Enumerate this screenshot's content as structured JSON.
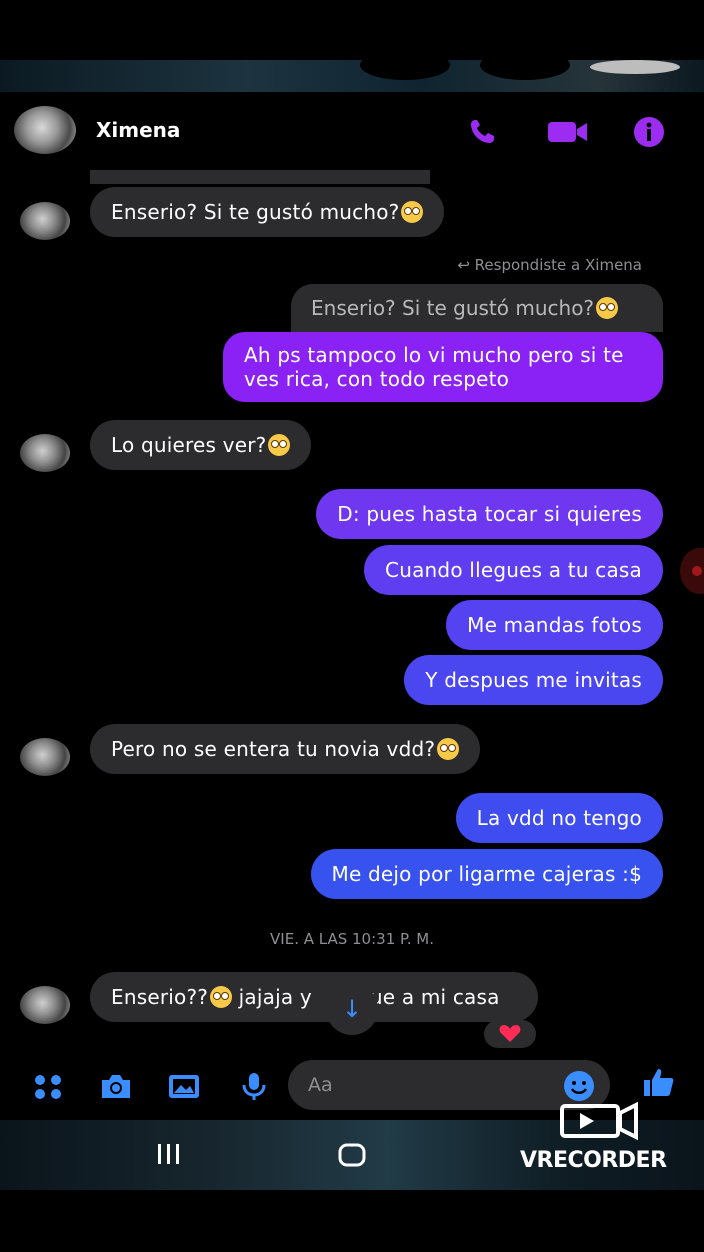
{
  "colors": {
    "accent_purple": "#9b2cf0",
    "accent_blue": "#3a8dff",
    "incoming_bubble": "#2c2c2e",
    "background": "#000000"
  },
  "header": {
    "contact_name": "Ximena",
    "icons": [
      "phone-icon",
      "video-camera-icon",
      "info-icon"
    ]
  },
  "reply_label": "Respondiste a Ximena",
  "messages": [
    {
      "side": "in",
      "text": "Enserio? Si te gustó mucho?",
      "emoji": true
    },
    {
      "side": "quote",
      "text": "Enserio? Si te gustó mucho?",
      "emoji": true
    },
    {
      "side": "out",
      "line1": "Ah ps tampoco lo vi mucho pero si te",
      "line2": "ves rica, con todo respeto"
    },
    {
      "side": "in",
      "text": "Lo quieres ver?",
      "emoji": true
    },
    {
      "side": "out",
      "text": "D: pues hasta tocar si quieres"
    },
    {
      "side": "out",
      "text": "Cuando llegues a tu casa"
    },
    {
      "side": "out",
      "text": "Me mandas fotos"
    },
    {
      "side": "out",
      "text": "Y despues me invitas"
    },
    {
      "side": "in",
      "text": "Pero no se entera tu novia vdd?",
      "emoji": true
    },
    {
      "side": "out",
      "text": "La vdd no tengo"
    },
    {
      "side": "out",
      "text": "Me dejo por ligarme cajeras :$"
    },
    {
      "side": "in",
      "part1": "Enserio??",
      "part2": " jajaja y",
      "part3": "ue a mi casa"
    }
  ],
  "timestamp": "VIE. A LAS 10:31 P. M.",
  "reaction": "heart",
  "composer": {
    "placeholder": "Aa",
    "icons": [
      "apps-icon",
      "camera-icon",
      "gallery-icon",
      "microphone-icon",
      "emoji-icon",
      "like-icon"
    ]
  },
  "nav": {
    "icons": [
      "recent-apps-icon",
      "home-icon"
    ]
  },
  "watermark": "RECORDER"
}
